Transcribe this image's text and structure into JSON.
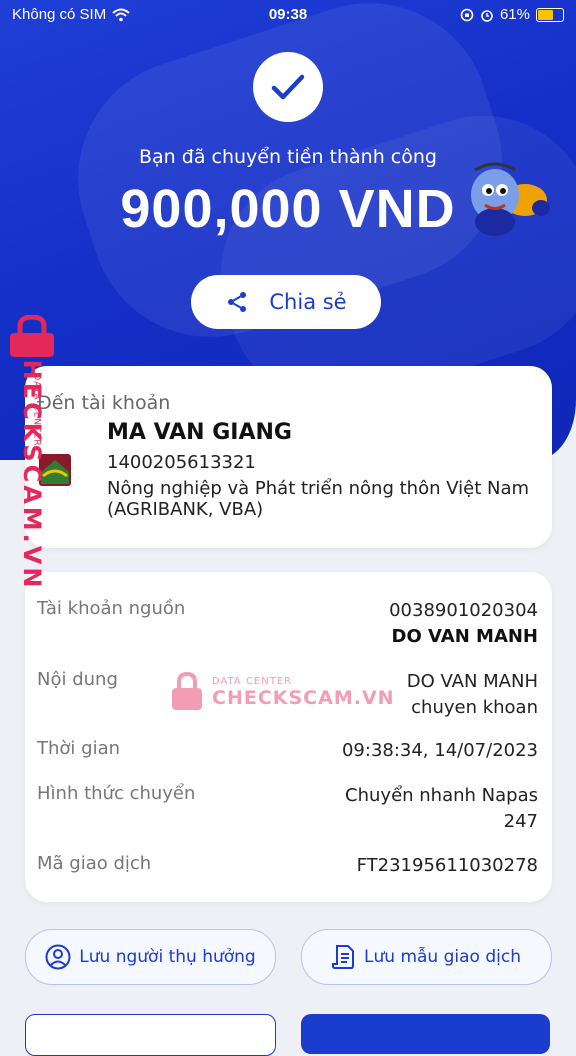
{
  "status_bar": {
    "carrier": "Không có SIM",
    "time": "09:38",
    "battery": "61%"
  },
  "hero": {
    "success_message": "Bạn đã chuyển tiền thành công",
    "amount": "900,000 VND",
    "share_label": "Chia sẻ"
  },
  "recipient": {
    "label": "Đến tài khoản",
    "name": "MA VAN GIANG",
    "account_number": "1400205613321",
    "bank": "Nông nghiệp và Phát triển nông thôn Việt Nam (AGRIBANK, VBA)"
  },
  "details": {
    "source_label": "Tài khoản nguồn",
    "source_account": "0038901020304",
    "source_name": "DO VAN MANH",
    "content_label": "Nội dung",
    "content_line1": "DO VAN MANH",
    "content_line2": "chuyen khoan",
    "time_label": "Thời gian",
    "time_value": "09:38:34, 14/07/2023",
    "method_label": "Hình thức chuyển",
    "method_line1": "Chuyển nhanh Napas",
    "method_line2": "247",
    "txn_label": "Mã giao dịch",
    "txn_value": "FT23195611030278"
  },
  "actions": {
    "save_beneficiary": "Lưu người thụ hưởng",
    "save_template": "Lưu mẫu giao dịch"
  },
  "watermark": {
    "brand": "CHECKSCAM.VN",
    "sub": "DATA CENTER"
  },
  "colors": {
    "primary": "#1a3ccf",
    "hero_bg": "#1530c8",
    "watermark": "#e5285a"
  }
}
